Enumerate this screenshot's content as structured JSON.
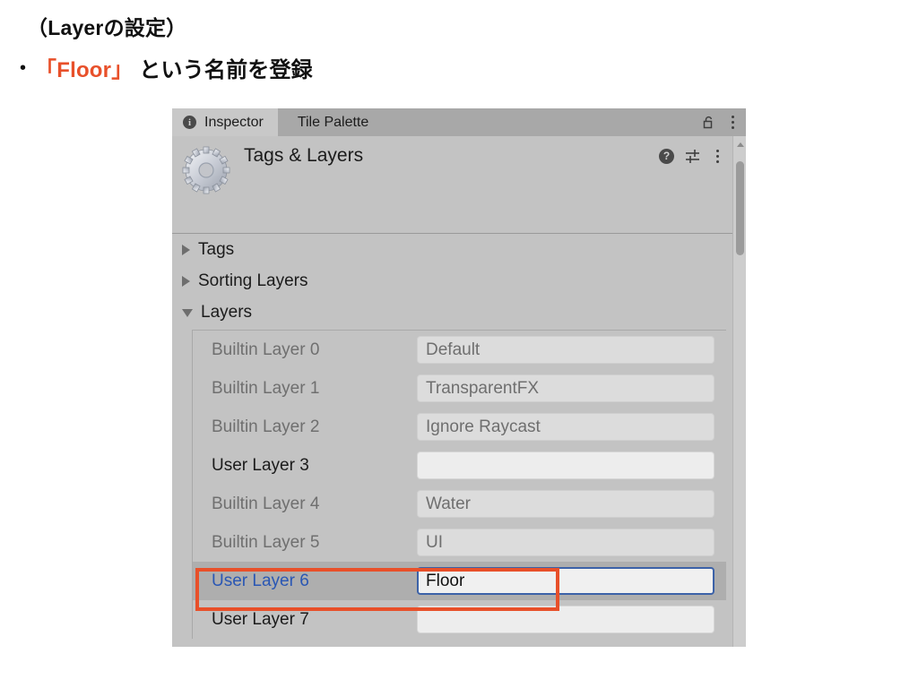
{
  "slide": {
    "title": "（Layerの設定）",
    "bullet_marker": "•",
    "bullet_prefix": "「Floor」",
    "bullet_suffix": " という名前を登録",
    "accent_color": "#E8502A"
  },
  "inspector": {
    "tabs": [
      {
        "label": "Inspector",
        "icon": "info-icon",
        "active": true
      },
      {
        "label": "Tile Palette",
        "icon": "",
        "active": false
      }
    ],
    "tabbar_icons": [
      "lock-open-icon",
      "kebab-menu-icon"
    ],
    "component": {
      "title": "Tags & Layers",
      "icon": "gear-icon",
      "header_icons": [
        "help-icon",
        "preset-icon",
        "kebab-menu-icon"
      ],
      "help_glyph": "?"
    },
    "foldouts": [
      {
        "label": "Tags",
        "expanded": false
      },
      {
        "label": "Sorting Layers",
        "expanded": false
      },
      {
        "label": "Layers",
        "expanded": true
      }
    ],
    "layers": [
      {
        "label": "Builtin Layer 0",
        "value": "Default",
        "editable": false,
        "selected": false
      },
      {
        "label": "Builtin Layer 1",
        "value": "TransparentFX",
        "editable": false,
        "selected": false
      },
      {
        "label": "Builtin Layer 2",
        "value": "Ignore Raycast",
        "editable": false,
        "selected": false
      },
      {
        "label": "User Layer 3",
        "value": "",
        "editable": true,
        "selected": false
      },
      {
        "label": "Builtin Layer 4",
        "value": "Water",
        "editable": false,
        "selected": false
      },
      {
        "label": "Builtin Layer 5",
        "value": "UI",
        "editable": false,
        "selected": false
      },
      {
        "label": "User Layer 6",
        "value": "Floor",
        "editable": true,
        "selected": true
      },
      {
        "label": "User Layer 7",
        "value": "",
        "editable": true,
        "selected": false
      }
    ],
    "annotation": {
      "target": "User Layer 6",
      "color": "#E8502A"
    },
    "scrollbar": {
      "orientation": "vertical",
      "position": "top"
    }
  }
}
